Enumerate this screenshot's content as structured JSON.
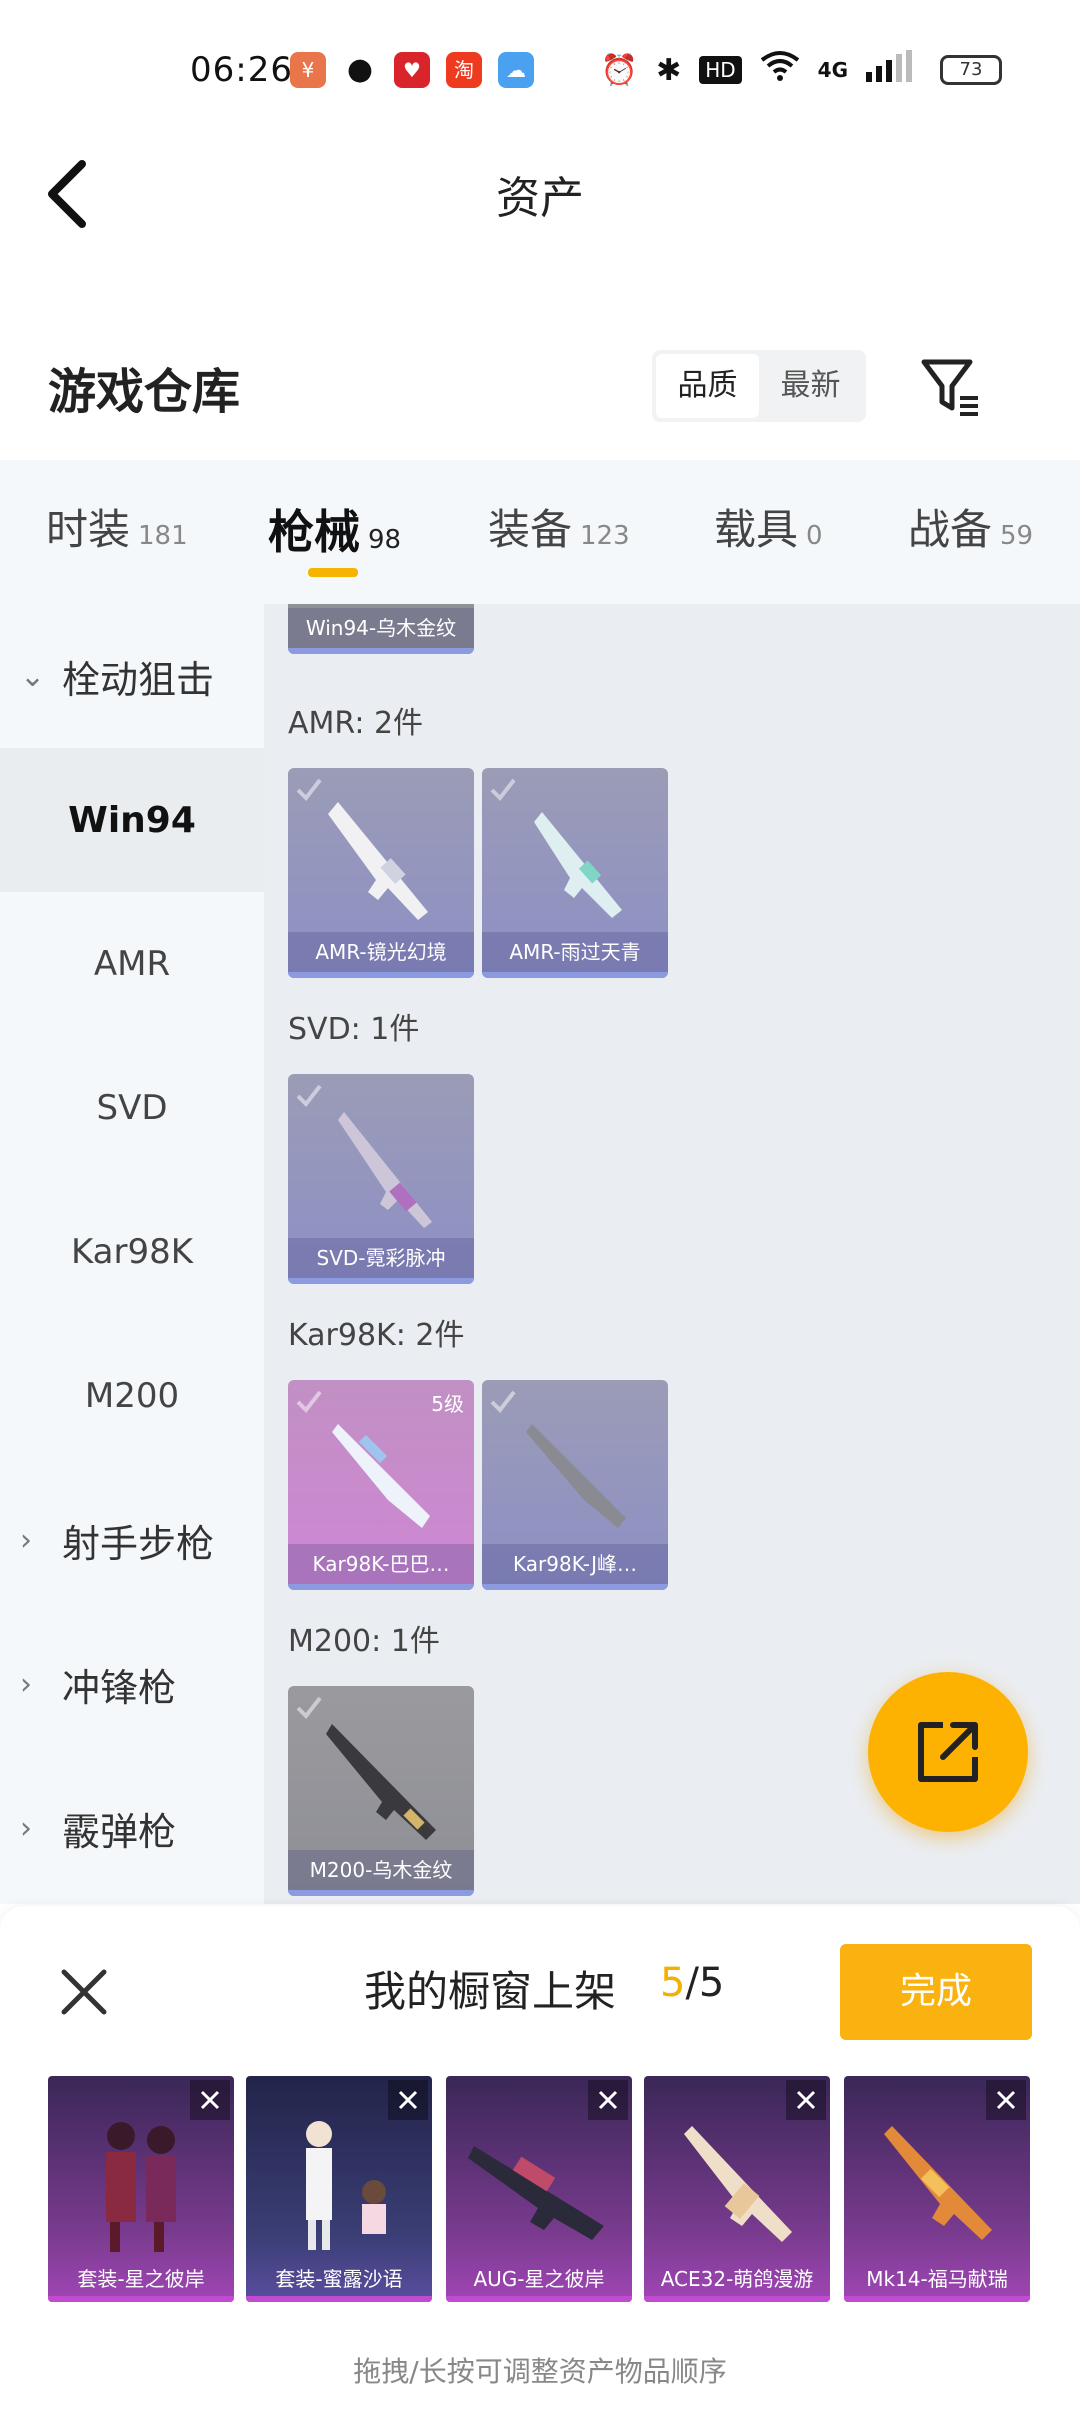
{
  "status_bar": {
    "time": "06:26",
    "network": "4G",
    "hd_badge": "HD",
    "battery": "73",
    "icons": [
      "alarm-icon",
      "bluetooth-icon",
      "wifi-icon",
      "signal-icon"
    ]
  },
  "header": {
    "title": "资产"
  },
  "section": {
    "title": "游戏仓库",
    "sort_options": [
      "品质",
      "最新"
    ],
    "sort_active": 0
  },
  "tabs": [
    {
      "label": "时装",
      "count": "181"
    },
    {
      "label": "枪械",
      "count": "98"
    },
    {
      "label": "装备",
      "count": "123"
    },
    {
      "label": "载具",
      "count": "0"
    },
    {
      "label": "战备",
      "count": "59"
    }
  ],
  "active_tab": 1,
  "sidebar": {
    "items": [
      {
        "label": "栓动狙击",
        "type": "group",
        "expanded": true
      },
      {
        "label": "Win94",
        "type": "sub",
        "active": true
      },
      {
        "label": "AMR",
        "type": "sub"
      },
      {
        "label": "SVD",
        "type": "sub"
      },
      {
        "label": "Kar98K",
        "type": "sub"
      },
      {
        "label": "M200",
        "type": "sub"
      },
      {
        "label": "射手步枪",
        "type": "group"
      },
      {
        "label": "冲锋枪",
        "type": "group"
      },
      {
        "label": "霰弹枪",
        "type": "group"
      }
    ]
  },
  "content": {
    "top_item": {
      "name": "Win94-乌木金纹"
    },
    "groups": [
      {
        "label": "AMR: 2件",
        "items": [
          {
            "name": "AMR-镜光幻境",
            "style": "purple"
          },
          {
            "name": "AMR-雨过天青",
            "style": "purple"
          }
        ]
      },
      {
        "label": "SVD: 1件",
        "items": [
          {
            "name": "SVD-霓彩脉冲",
            "style": "purple"
          }
        ]
      },
      {
        "label": "Kar98K: 2件",
        "items": [
          {
            "name": "Kar98K-巴巴…",
            "style": "pink",
            "level": "5级"
          },
          {
            "name": "Kar98K-J峰…",
            "style": "purple"
          }
        ]
      },
      {
        "label": "M200: 1件",
        "items": [
          {
            "name": "M200-乌木金纹",
            "style": "gray"
          }
        ]
      }
    ]
  },
  "bottom_panel": {
    "title": "我的橱窗上架",
    "count_current": "5",
    "count_total": "/5",
    "done_label": "完成",
    "items": [
      {
        "name": "套装-星之彼岸"
      },
      {
        "name": "套装-蜜露沙语"
      },
      {
        "name": "AUG-星之彼岸"
      },
      {
        "name": "ACE32-萌鸽漫游"
      },
      {
        "name": "Mk14-福马献瑞"
      }
    ],
    "hint": "拖拽/长按可调整资产物品顺序"
  },
  "colors": {
    "accent": "#f9b20f",
    "tab_indicator": "#f5b400",
    "sidebar_bg": "#f5f8fb",
    "content_bg": "#eaedf1"
  }
}
